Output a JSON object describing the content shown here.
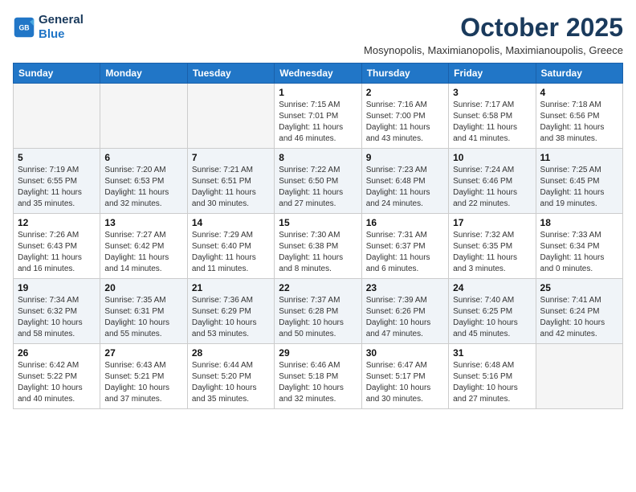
{
  "header": {
    "logo_line1": "General",
    "logo_line2": "Blue",
    "month": "October 2025",
    "subtitle": "Mosynopolis, Maximianopolis, Maximianoupolis, Greece"
  },
  "days_of_week": [
    "Sunday",
    "Monday",
    "Tuesday",
    "Wednesday",
    "Thursday",
    "Friday",
    "Saturday"
  ],
  "weeks": [
    [
      {
        "num": "",
        "empty": true
      },
      {
        "num": "",
        "empty": true
      },
      {
        "num": "",
        "empty": true
      },
      {
        "num": "1",
        "sunrise": "7:15 AM",
        "sunset": "7:01 PM",
        "daylight": "11 hours and 46 minutes."
      },
      {
        "num": "2",
        "sunrise": "7:16 AM",
        "sunset": "7:00 PM",
        "daylight": "11 hours and 43 minutes."
      },
      {
        "num": "3",
        "sunrise": "7:17 AM",
        "sunset": "6:58 PM",
        "daylight": "11 hours and 41 minutes."
      },
      {
        "num": "4",
        "sunrise": "7:18 AM",
        "sunset": "6:56 PM",
        "daylight": "11 hours and 38 minutes."
      }
    ],
    [
      {
        "num": "5",
        "sunrise": "7:19 AM",
        "sunset": "6:55 PM",
        "daylight": "11 hours and 35 minutes."
      },
      {
        "num": "6",
        "sunrise": "7:20 AM",
        "sunset": "6:53 PM",
        "daylight": "11 hours and 32 minutes."
      },
      {
        "num": "7",
        "sunrise": "7:21 AM",
        "sunset": "6:51 PM",
        "daylight": "11 hours and 30 minutes."
      },
      {
        "num": "8",
        "sunrise": "7:22 AM",
        "sunset": "6:50 PM",
        "daylight": "11 hours and 27 minutes."
      },
      {
        "num": "9",
        "sunrise": "7:23 AM",
        "sunset": "6:48 PM",
        "daylight": "11 hours and 24 minutes."
      },
      {
        "num": "10",
        "sunrise": "7:24 AM",
        "sunset": "6:46 PM",
        "daylight": "11 hours and 22 minutes."
      },
      {
        "num": "11",
        "sunrise": "7:25 AM",
        "sunset": "6:45 PM",
        "daylight": "11 hours and 19 minutes."
      }
    ],
    [
      {
        "num": "12",
        "sunrise": "7:26 AM",
        "sunset": "6:43 PM",
        "daylight": "11 hours and 16 minutes."
      },
      {
        "num": "13",
        "sunrise": "7:27 AM",
        "sunset": "6:42 PM",
        "daylight": "11 hours and 14 minutes."
      },
      {
        "num": "14",
        "sunrise": "7:29 AM",
        "sunset": "6:40 PM",
        "daylight": "11 hours and 11 minutes."
      },
      {
        "num": "15",
        "sunrise": "7:30 AM",
        "sunset": "6:38 PM",
        "daylight": "11 hours and 8 minutes."
      },
      {
        "num": "16",
        "sunrise": "7:31 AM",
        "sunset": "6:37 PM",
        "daylight": "11 hours and 6 minutes."
      },
      {
        "num": "17",
        "sunrise": "7:32 AM",
        "sunset": "6:35 PM",
        "daylight": "11 hours and 3 minutes."
      },
      {
        "num": "18",
        "sunrise": "7:33 AM",
        "sunset": "6:34 PM",
        "daylight": "11 hours and 0 minutes."
      }
    ],
    [
      {
        "num": "19",
        "sunrise": "7:34 AM",
        "sunset": "6:32 PM",
        "daylight": "10 hours and 58 minutes."
      },
      {
        "num": "20",
        "sunrise": "7:35 AM",
        "sunset": "6:31 PM",
        "daylight": "10 hours and 55 minutes."
      },
      {
        "num": "21",
        "sunrise": "7:36 AM",
        "sunset": "6:29 PM",
        "daylight": "10 hours and 53 minutes."
      },
      {
        "num": "22",
        "sunrise": "7:37 AM",
        "sunset": "6:28 PM",
        "daylight": "10 hours and 50 minutes."
      },
      {
        "num": "23",
        "sunrise": "7:39 AM",
        "sunset": "6:26 PM",
        "daylight": "10 hours and 47 minutes."
      },
      {
        "num": "24",
        "sunrise": "7:40 AM",
        "sunset": "6:25 PM",
        "daylight": "10 hours and 45 minutes."
      },
      {
        "num": "25",
        "sunrise": "7:41 AM",
        "sunset": "6:24 PM",
        "daylight": "10 hours and 42 minutes."
      }
    ],
    [
      {
        "num": "26",
        "sunrise": "6:42 AM",
        "sunset": "5:22 PM",
        "daylight": "10 hours and 40 minutes."
      },
      {
        "num": "27",
        "sunrise": "6:43 AM",
        "sunset": "5:21 PM",
        "daylight": "10 hours and 37 minutes."
      },
      {
        "num": "28",
        "sunrise": "6:44 AM",
        "sunset": "5:20 PM",
        "daylight": "10 hours and 35 minutes."
      },
      {
        "num": "29",
        "sunrise": "6:46 AM",
        "sunset": "5:18 PM",
        "daylight": "10 hours and 32 minutes."
      },
      {
        "num": "30",
        "sunrise": "6:47 AM",
        "sunset": "5:17 PM",
        "daylight": "10 hours and 30 minutes."
      },
      {
        "num": "31",
        "sunrise": "6:48 AM",
        "sunset": "5:16 PM",
        "daylight": "10 hours and 27 minutes."
      },
      {
        "num": "",
        "empty": true
      }
    ]
  ]
}
